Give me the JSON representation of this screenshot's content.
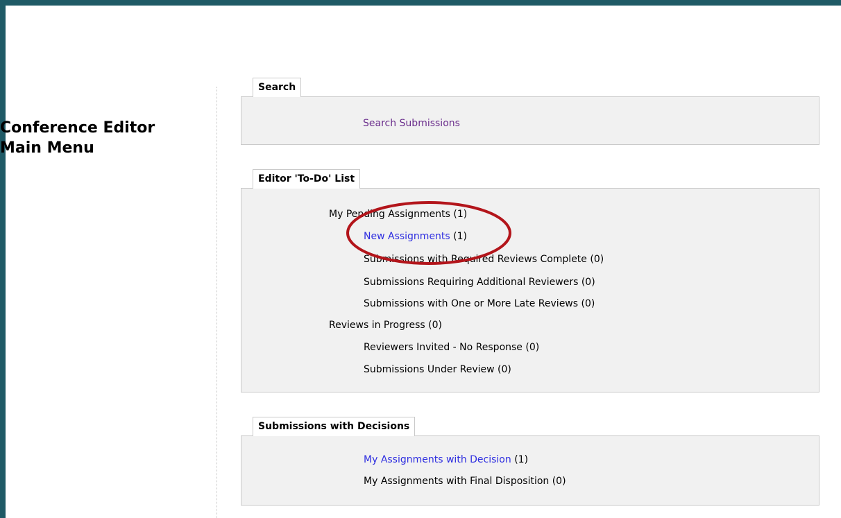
{
  "page": {
    "title_line1": "Conference Editor",
    "title_line2": "Main Menu"
  },
  "search": {
    "header": "Search",
    "search_submissions": "Search Submissions"
  },
  "todo": {
    "header": "Editor 'To-Do' List",
    "pending": "My Pending Assignments (1)",
    "new_assignments_link": "New Assignments",
    "new_assignments_count": " (1)",
    "required_reviews": "Submissions with Required Reviews Complete (0)",
    "additional_reviewers": "Submissions Requiring Additional Reviewers (0)",
    "late_reviews": "Submissions with One or More Late Reviews (0)",
    "reviews_in_progress": "Reviews in Progress (0)",
    "reviewers_invited": "Reviewers Invited - No Response (0)",
    "under_review": "Submissions Under Review (0)"
  },
  "decisions": {
    "header": "Submissions with Decisions",
    "with_decision_link": "My Assignments with Decision",
    "with_decision_count": " (1)",
    "final_disposition": "My Assignments with Final Disposition (0)"
  },
  "colors": {
    "frame": "#1f5a66",
    "link": "#2d2de0",
    "visited_link": "#6a2d8c",
    "annotation": "#b3151b",
    "panel": "#f1f1f1"
  }
}
